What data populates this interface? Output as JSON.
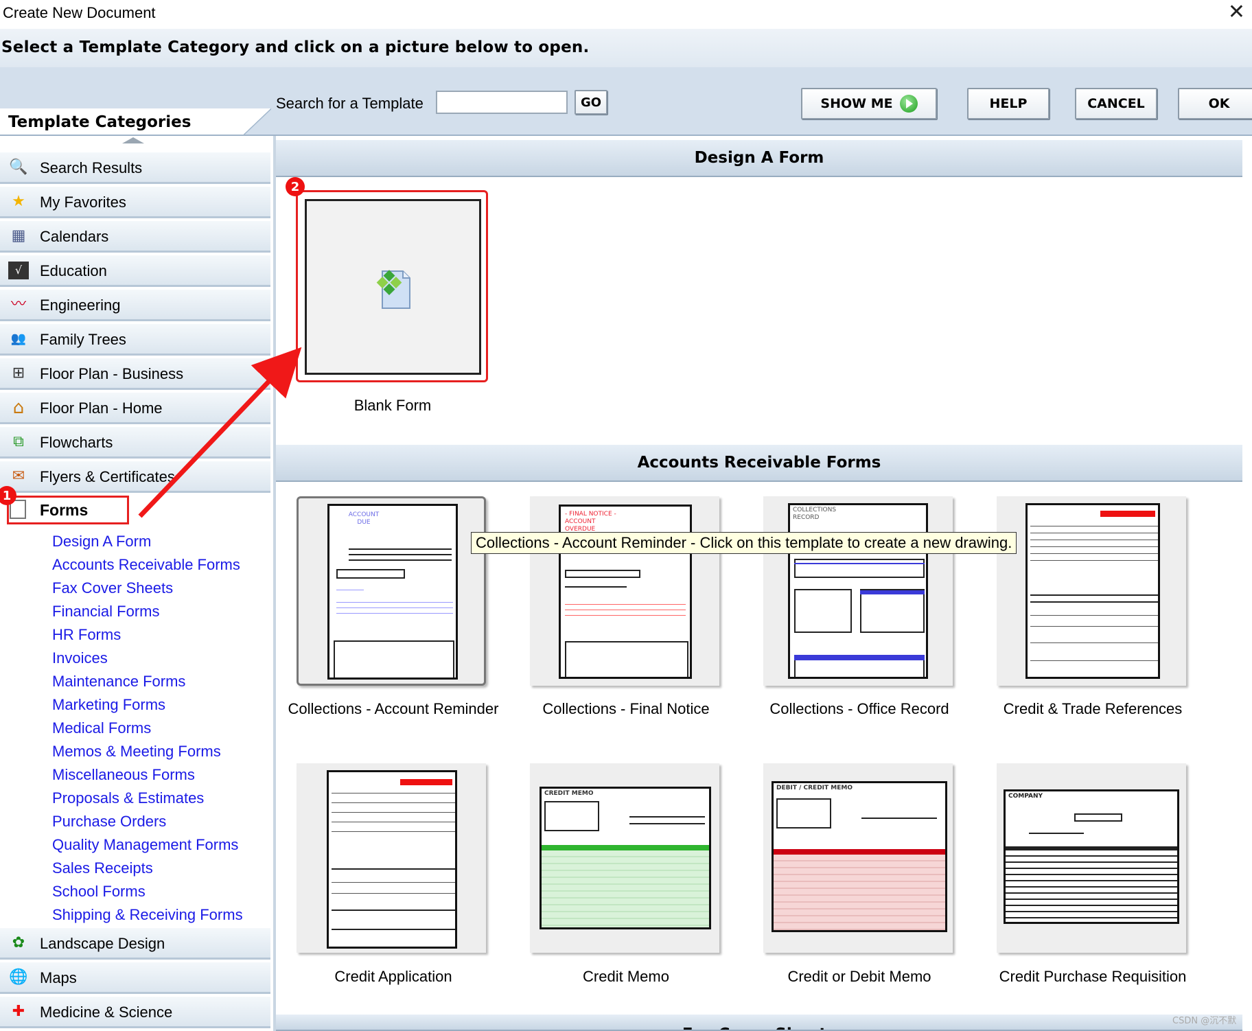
{
  "window": {
    "title": "Create New Document",
    "close_glyph": "✕"
  },
  "instruction": "Select a Template Category and click on a picture below to open.",
  "toolbar": {
    "categories_title": "Template Categories",
    "search_label": "Search for a Template",
    "search_value": "",
    "go_label": "GO",
    "show_me_label": "SHOW ME",
    "help_label": "HELP",
    "cancel_label": "CANCEL",
    "ok_label": "OK"
  },
  "categories": [
    {
      "label": "Search Results",
      "icon": "magnifier-icon",
      "glyph": "🔍"
    },
    {
      "label": "My Favorites",
      "icon": "star-icon",
      "glyph": "★"
    },
    {
      "label": "Calendars",
      "icon": "calendar-icon",
      "glyph": "▦"
    },
    {
      "label": "Education",
      "icon": "math-board-icon",
      "glyph": "√"
    },
    {
      "label": "Engineering",
      "icon": "waveform-icon",
      "glyph": "〰"
    },
    {
      "label": "Family Trees",
      "icon": "people-icon",
      "glyph": "👥"
    },
    {
      "label": "Floor Plan - Business",
      "icon": "floorplan-icon",
      "glyph": "⊞"
    },
    {
      "label": "Floor Plan - Home",
      "icon": "house-icon",
      "glyph": "⌂"
    },
    {
      "label": "Flowcharts",
      "icon": "flowchart-icon",
      "glyph": "⧉"
    },
    {
      "label": "Flyers & Certificates",
      "icon": "certificate-icon",
      "glyph": "✉"
    }
  ],
  "forms_category": {
    "label": "Forms",
    "subcategories": [
      "Design A Form",
      "Accounts Receivable Forms",
      "Fax Cover Sheets",
      "Financial Forms",
      "HR Forms",
      "Invoices",
      "Maintenance Forms",
      "Marketing Forms",
      "Medical Forms",
      "Memos & Meeting Forms",
      "Miscellaneous Forms",
      "Proposals & Estimates",
      "Purchase Orders",
      "Quality Management Forms",
      "Sales Receipts",
      "School Forms",
      "Shipping & Receiving Forms"
    ]
  },
  "categories_after": [
    {
      "label": "Landscape Design",
      "icon": "landscape-icon",
      "glyph": "✿"
    },
    {
      "label": "Maps",
      "icon": "globe-icon",
      "glyph": "🌐"
    },
    {
      "label": "Medicine & Science",
      "icon": "medical-cross-icon",
      "glyph": "✚"
    }
  ],
  "annotations": {
    "badge1": "1",
    "badge2": "2"
  },
  "sections": {
    "design": {
      "title": "Design A Form",
      "blank_label": "Blank Form"
    },
    "accounts": {
      "title": "Accounts Receivable Forms",
      "templates": [
        "Collections - Account Reminder",
        "Collections - Final Notice",
        "Collections - Office Record",
        "Credit & Trade References",
        "Credit Application",
        "Credit Memo",
        "Credit or Debit Memo",
        "Credit Purchase Requisition"
      ]
    },
    "next_partial_title": "Fax Cover Sheets"
  },
  "thumb_text": {
    "account_due": "ACCOUNT DUE",
    "final_notice": "- FINAL NOTICE - ACCOUNT OVERDUE",
    "office_record": "COLLECTIONS RECORD",
    "credit_memo": "CREDIT MEMO",
    "debit_credit_memo": "DEBIT / CREDIT MEMO",
    "company": "COMPANY"
  },
  "tooltip": "Collections - Account Reminder - Click on this template to create a new drawing.",
  "watermark": "CSDN @沉不默",
  "colors": {
    "highlight_red": "#e62020",
    "link_blue": "#1a1ae6",
    "header_blue": "#c8d6e4"
  }
}
